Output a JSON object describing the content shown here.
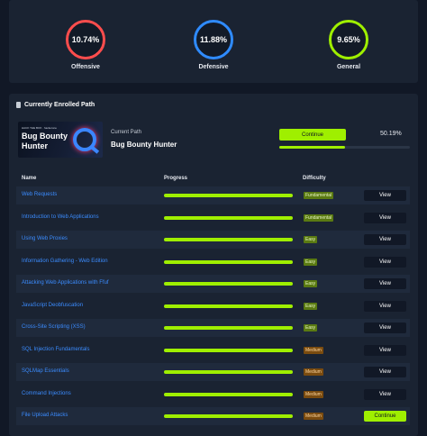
{
  "colors": {
    "accent_green": "#9fef00",
    "link_blue": "#3b8cff",
    "offensive": "#ff4d4d",
    "defensive": "#2f8bff",
    "general": "#9fef00",
    "card_bg": "#1a2332",
    "page_bg": "#111826"
  },
  "stats": [
    {
      "label": "Offensive",
      "value": "10.74%",
      "color": "#ff4d4d"
    },
    {
      "label": "Defensive",
      "value": "11.88%",
      "color": "#2f8bff"
    },
    {
      "label": "General",
      "value": "9.65%",
      "color": "#9fef00"
    }
  ],
  "enrolled": {
    "section_title": "Currently Enrolled Path",
    "section_icon": "book-icon",
    "cover_logos": "HACK THE BOX · hackerone",
    "cover_title": "Bug Bounty Hunter",
    "cover_icon": "magnifier-icon",
    "current_path_label": "Current Path",
    "path_name": "Bug Bounty Hunter",
    "continue_label": "Continue",
    "progress_text": "50.19%",
    "progress_fraction": 0.5019
  },
  "table": {
    "headers": {
      "name": "Name",
      "progress": "Progress",
      "difficulty": "Difficulty"
    },
    "rows": [
      {
        "name": "Web Requests",
        "progress": 1.0,
        "difficulty": "Fundamental",
        "action": "View"
      },
      {
        "name": "Introduction to Web Applications",
        "progress": 1.0,
        "difficulty": "Fundamental",
        "action": "View"
      },
      {
        "name": "Using Web Proxies",
        "progress": 1.0,
        "difficulty": "Easy",
        "action": "View"
      },
      {
        "name": "Information Gathering - Web Edition",
        "progress": 1.0,
        "difficulty": "Easy",
        "action": "View"
      },
      {
        "name": "Attacking Web Applications with Ffuf",
        "progress": 1.0,
        "difficulty": "Easy",
        "action": "View"
      },
      {
        "name": "JavaScript Deobfuscation",
        "progress": 1.0,
        "difficulty": "Easy",
        "action": "View"
      },
      {
        "name": "Cross-Site Scripting (XSS)",
        "progress": 1.0,
        "difficulty": "Easy",
        "action": "View"
      },
      {
        "name": "SQL Injection Fundamentals",
        "progress": 1.0,
        "difficulty": "Medium",
        "action": "View"
      },
      {
        "name": "SQLMap Essentials",
        "progress": 1.0,
        "difficulty": "Medium",
        "action": "View"
      },
      {
        "name": "Command Injections",
        "progress": 1.0,
        "difficulty": "Medium",
        "action": "View"
      },
      {
        "name": "File Upload Attacks",
        "progress": 1.0,
        "difficulty": "Medium",
        "action": "Continue"
      }
    ]
  }
}
